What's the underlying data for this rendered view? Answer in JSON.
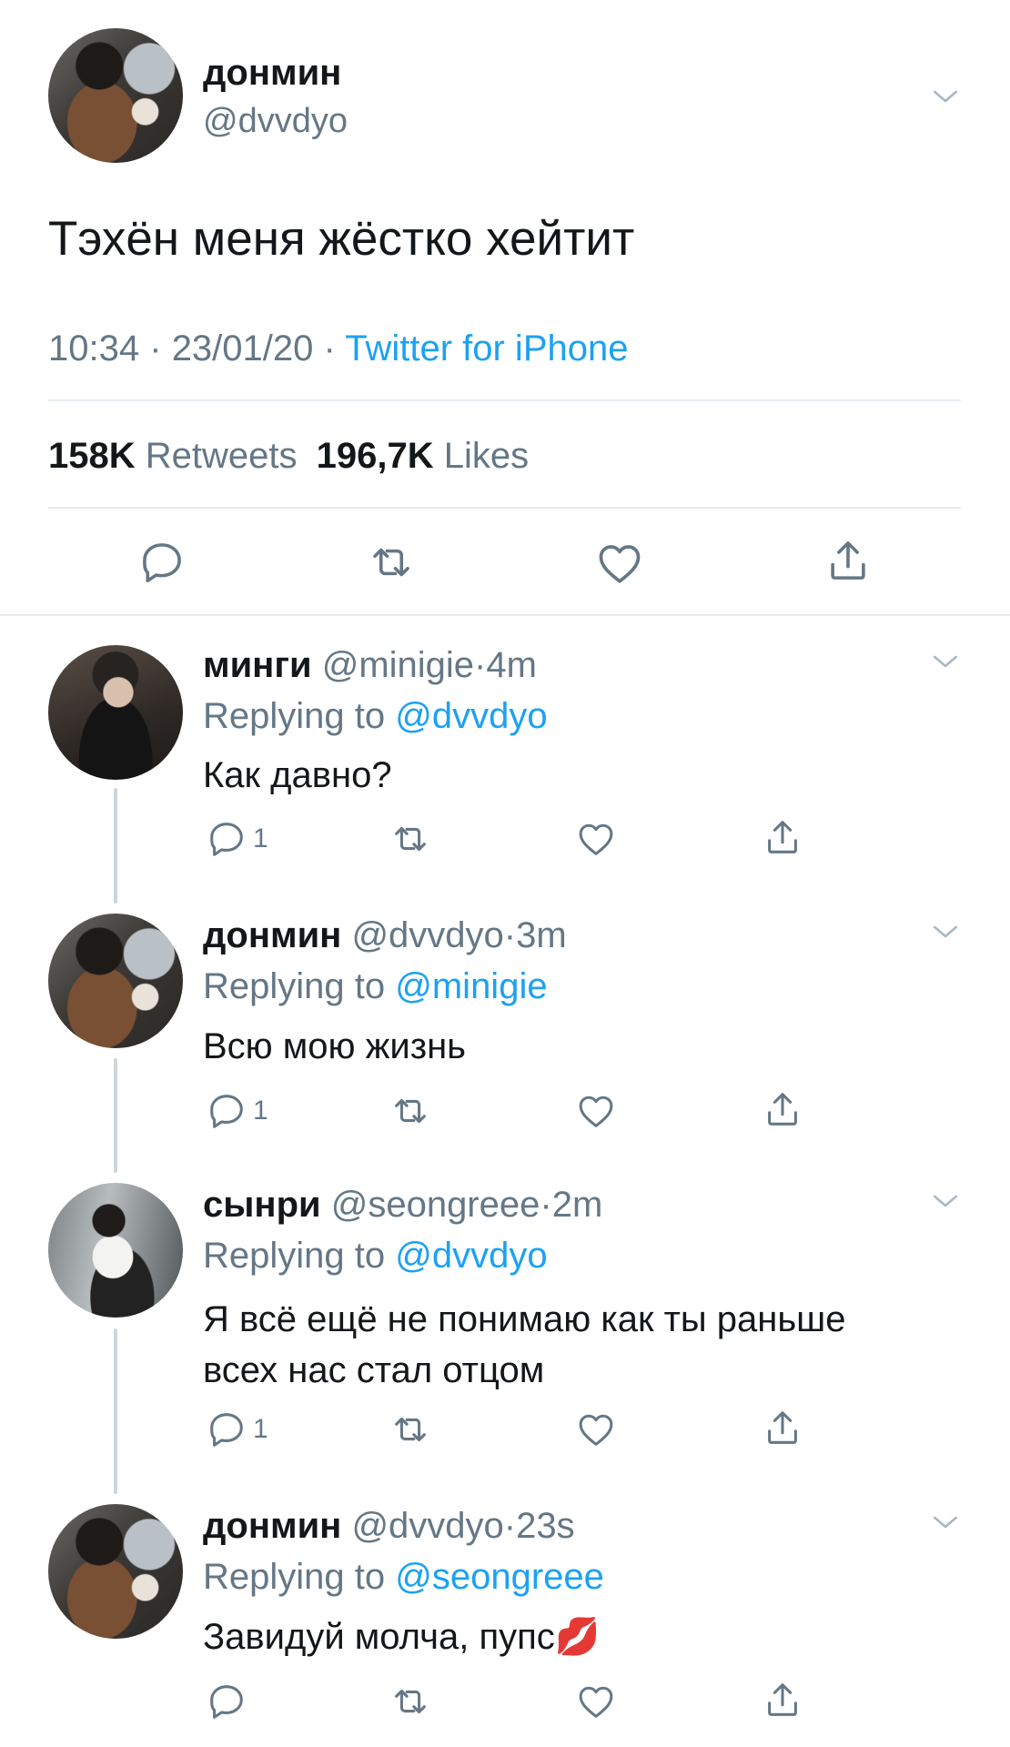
{
  "main_tweet": {
    "name": "донмин",
    "handle": "@dvvdyo",
    "text": "Тэхён меня жёстко хейтит",
    "time": "10:34",
    "date": "23/01/20",
    "separator": "·",
    "source": "Twitter for iPhone",
    "retweets_count": "158K",
    "retweets_label": "Retweets",
    "likes_count": "196,7K",
    "likes_label": "Likes"
  },
  "replies": [
    {
      "name": "минги",
      "handle": "@minigie",
      "time": "4m",
      "replying_prefix": "Replying to",
      "replying_to": "@dvvdyo",
      "text": "Как давно?",
      "reply_count": "1"
    },
    {
      "name": "донмин",
      "handle": "@dvvdyo",
      "time": "3m",
      "replying_prefix": "Replying to",
      "replying_to": "@minigie",
      "text": "Всю мою жизнь",
      "reply_count": "1"
    },
    {
      "name": "сынри",
      "handle": "@seongreee",
      "time": "2m",
      "replying_prefix": "Replying to",
      "replying_to": "@dvvdyo",
      "text_line1": "Я всё ещё не понимаю как ты раньше",
      "text_line2": "всех нас стал отцом",
      "reply_count": "1"
    },
    {
      "name": "донмин",
      "handle": "@dvvdyo",
      "time": "23s",
      "replying_prefix": "Replying to",
      "replying_to": "@seongreee",
      "text": "Завидуй молча, пупс",
      "emoji": "💋"
    }
  ],
  "icons": {
    "reply": "reply-icon",
    "retweet": "retweet-icon",
    "like": "heart-icon",
    "share": "share-icon",
    "more": "chevron-down-icon"
  },
  "colors": {
    "link": "#1da1f2",
    "secondary": "#657786",
    "text": "#14171a",
    "divider": "#e6ecf0",
    "thread_line": "#ccd6dd"
  }
}
